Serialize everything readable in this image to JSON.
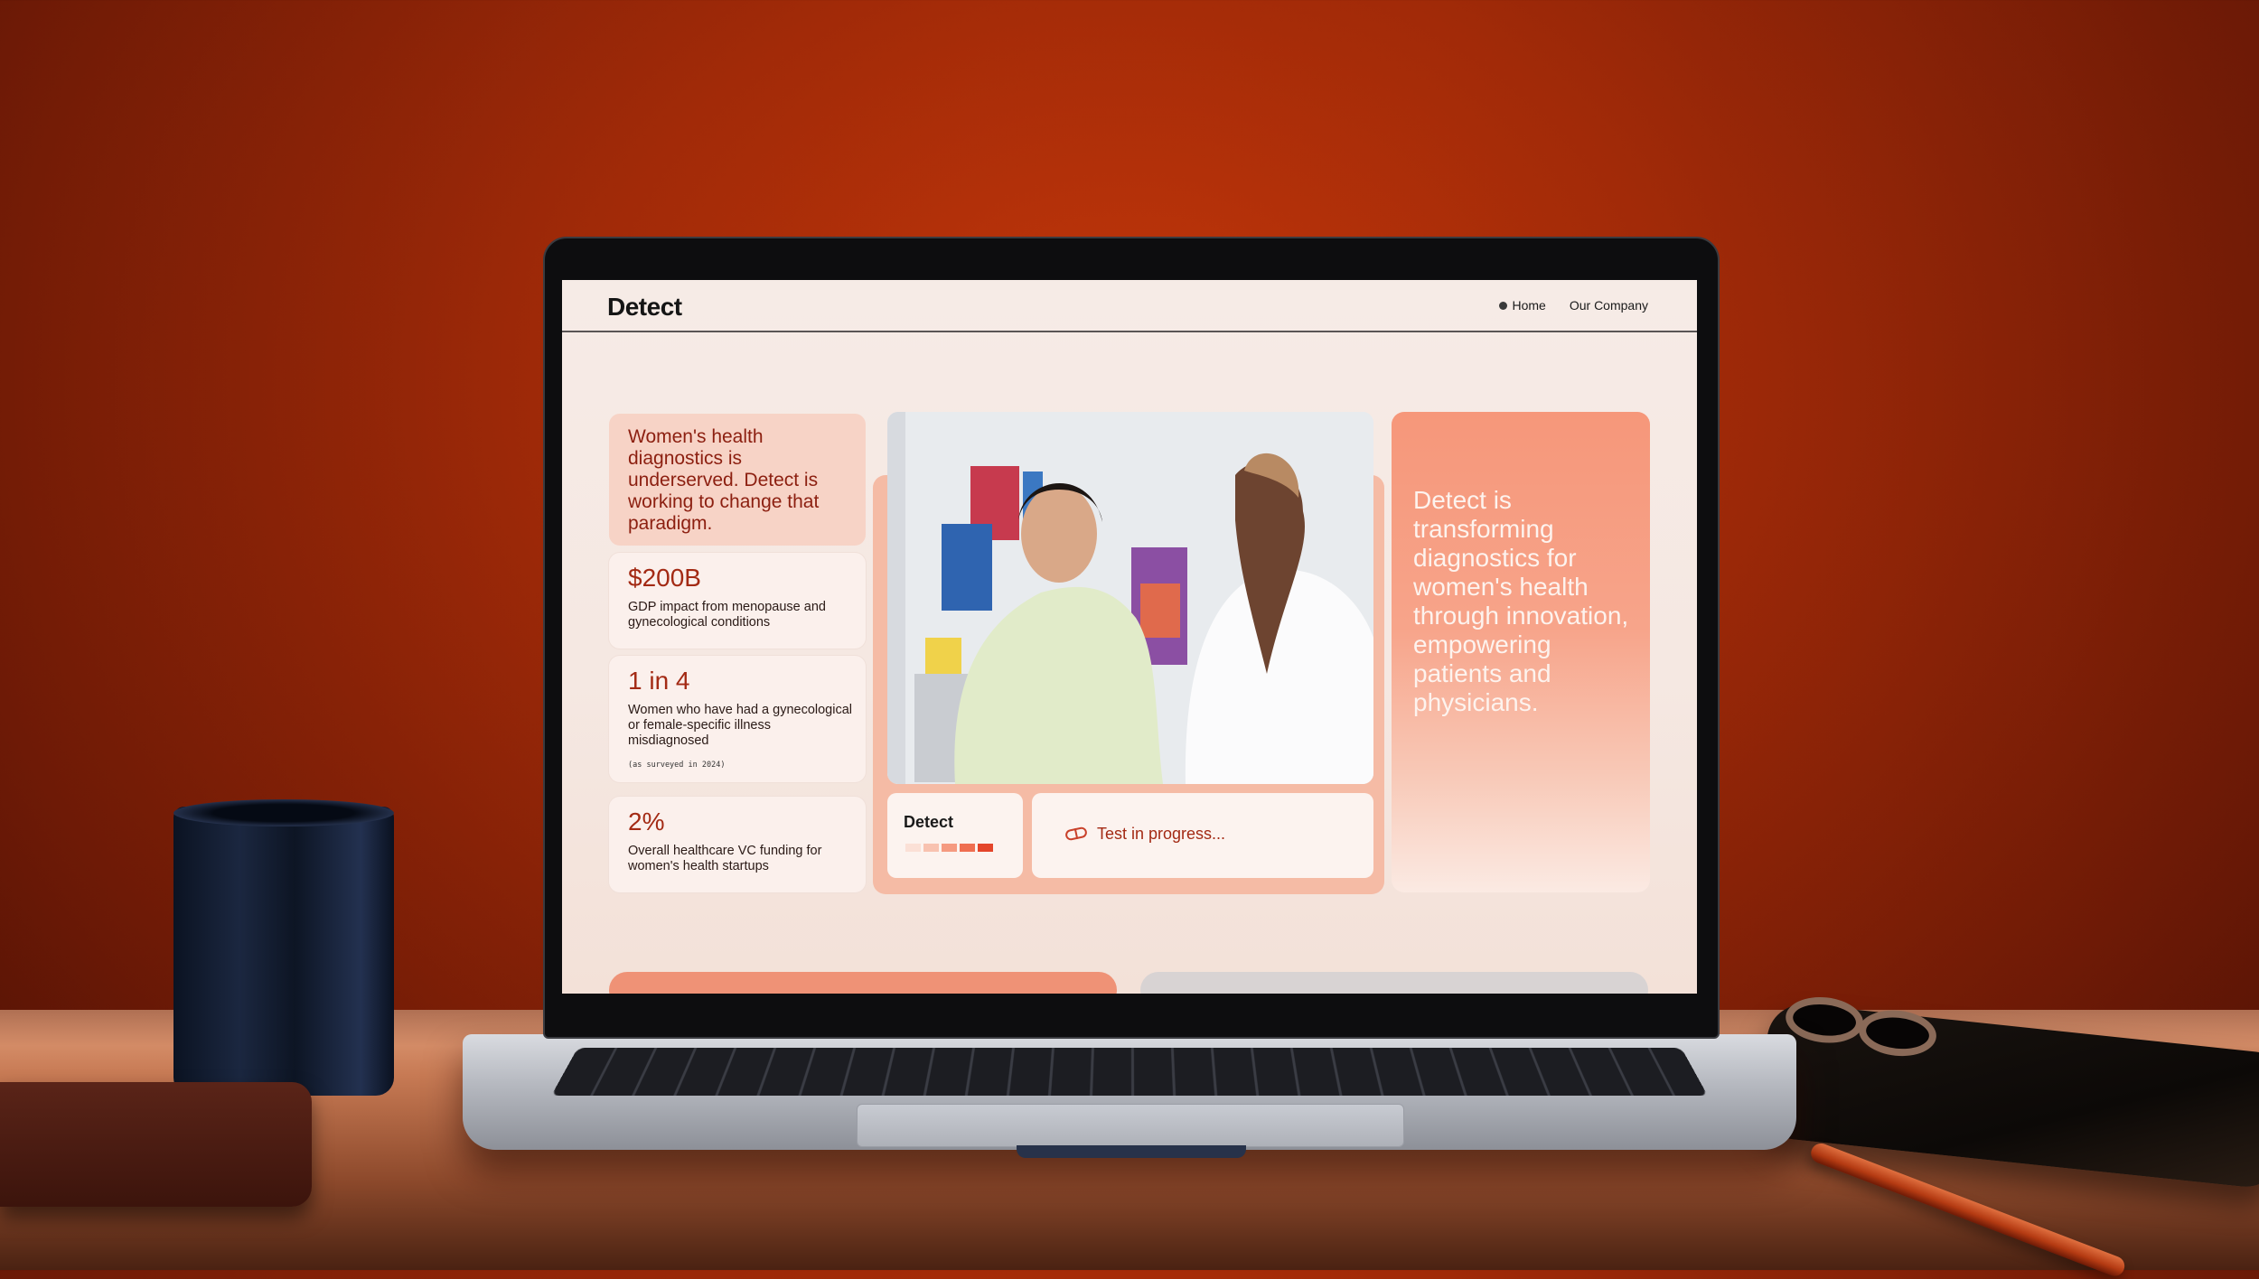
{
  "site": {
    "logo": "Detect",
    "nav": [
      {
        "label": "Home",
        "active": true
      },
      {
        "label": "Our Company",
        "active": false
      }
    ]
  },
  "intro": {
    "text": "Women's health diagnostics is underserved. Detect is working to change that paradigm."
  },
  "stats": [
    {
      "value": "$200B",
      "description": "GDP impact from menopause and gynecological conditions",
      "note": ""
    },
    {
      "value": "1 in 4",
      "description": "Women who have had a gynecological or female-specific illness misdiagnosed",
      "note": "(as surveyed in 2024)"
    },
    {
      "value": "2%",
      "description": "Overall healthcare VC funding for women's health startups",
      "note": ""
    }
  ],
  "device_card": {
    "label": "Detect",
    "bar_colors": [
      "#fbe0d6",
      "#f8c2b0",
      "#f59a80",
      "#ef6e50",
      "#e4452a"
    ]
  },
  "status_card": {
    "text": "Test in progress...",
    "icon": "pill-icon"
  },
  "hero": {
    "statement": "Detect is transforming diagnostics for women's health through innovation, empowering patients and physicians."
  },
  "colors": {
    "accent": "#a32a14",
    "panel": "#f6977a",
    "card_bg": "#fbf0ec"
  }
}
